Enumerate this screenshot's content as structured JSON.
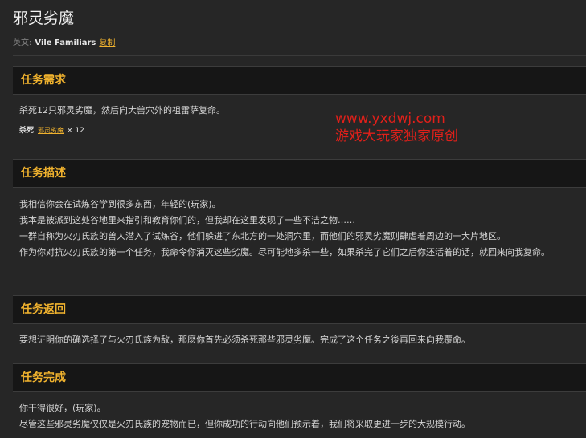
{
  "page": {
    "title": "邪灵劣魔",
    "english_label": "英文:",
    "english_name": "Vile Familiars",
    "copy_link": "复制"
  },
  "watermark": {
    "line1": "www.yxdwj.com",
    "line2": "游戏大玩家独家原创"
  },
  "sections": {
    "requirements": {
      "title": "任务需求",
      "text": "杀死12只邪灵劣魔，然后向大兽穴外的祖雷萨复命。",
      "kill_label": "杀死",
      "kill_target": "邪灵劣魔",
      "kill_count": "× 12"
    },
    "description": {
      "title": "任务描述",
      "lines": [
        "我相信你会在试炼谷学到很多东西，年轻的(玩家)。",
        "我本是被派到这处谷地里来指引和教育你们的，但我却在这里发现了一些不洁之物……",
        "一群自称为火刃氏族的兽人潜入了试炼谷，他们躲进了东北方的一处洞穴里，而他们的邪灵劣魔则肆虐着周边的一大片地区。",
        "作为你对抗火刃氏族的第一个任务，我命令你消灭这些劣魔。尽可能地多杀一些，如果杀完了它们之后你还活着的话，就回来向我复命。"
      ]
    },
    "return": {
      "title": "任务返回",
      "text": "要想证明你的确选择了与火刃氏族为敌，那麽你首先必须杀死那些邪灵劣魔。完成了这个任务之後再回来向我覆命。"
    },
    "complete": {
      "title": "任务完成",
      "lines": [
        "你干得很好，(玩家)。",
        "尽管这些邪灵劣魔仅仅是火刃氏族的宠物而已，但你成功的行动向他们预示着，我们将采取更进一步的大规模行动。"
      ]
    }
  }
}
